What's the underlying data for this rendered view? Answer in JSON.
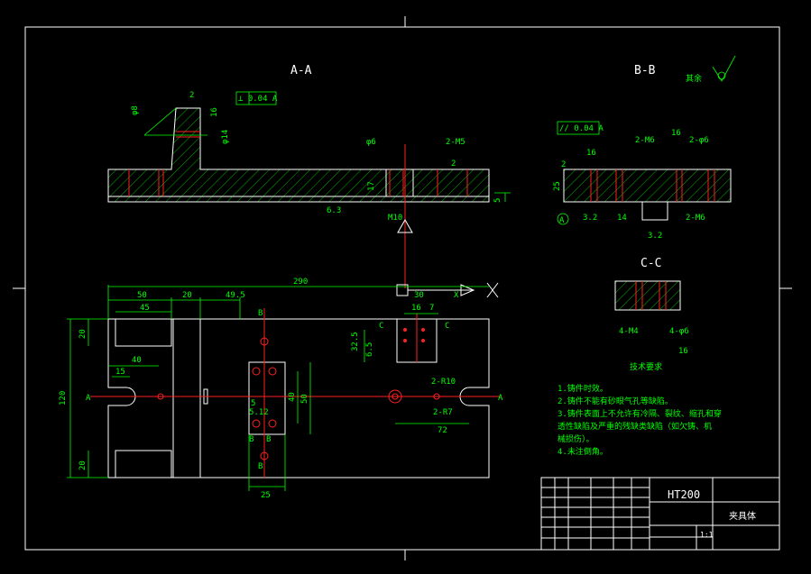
{
  "views": {
    "aa": "A-A",
    "bb": "B-B",
    "cc": "C-C"
  },
  "surface_note": "其余",
  "labels": {
    "lbl_2_top": "2",
    "lbl_tol_aa": "⊥ 0.04 A",
    "lbl_phi14": "φ14",
    "lbl_16_aa": "16",
    "lbl_phi8": "φ8",
    "lbl_63": "6.3",
    "lbl_2m5_aa": "2-M5",
    "lbl_phi6": "φ6",
    "lbl_2_aa": "2",
    "lbl_17": "17",
    "lbl_m10": "M10",
    "lbl_5_aa": "5",
    "lbl_tol_bb": "// 0.04 A",
    "lbl_16_bb": "16",
    "lbl_2m6_bb": "2-M6",
    "lbl_2_bb": "2",
    "lbl_25_bb": "25",
    "lbl_A_circle": "A",
    "lbl_32a": "3.2",
    "lbl_14": "14",
    "lbl_32b": "3.2",
    "lbl_2m6_bb2": "2-M6",
    "lbl_16_bb2": "16",
    "lbl_2m6_bb3": "2-φ6",
    "lbl_4m4": "4-M4",
    "lbl_4phi6": "4-φ6",
    "lbl_16_cc": "16",
    "dim_290": "290",
    "dim_50": "50",
    "dim_20": "20",
    "dim_495": "49.5",
    "dim_45": "45",
    "dim_16": "16",
    "dim_7": "7",
    "dim_C1": "C",
    "dim_C2": "C",
    "dim_325": "32.5",
    "dim_65": "6.5",
    "dim_20a": "20",
    "dim_40": "40",
    "dim_15": "15",
    "dim_120": "120",
    "dim_20b": "20",
    "dim_B1": "B",
    "dim_B2": "B",
    "dim_B3": "B",
    "dim_B4": "B",
    "dim_A_left": "A",
    "dim_A_right": "A",
    "dim_40b": "40",
    "dim_50b": "50",
    "dim_512": "5.12",
    "dim_5": "5",
    "dim_2r10": "2-R10",
    "dim_2r7": "2-R7",
    "dim_72": "72",
    "dim_25": "25",
    "dim_30": "30",
    "axis_x": "X"
  },
  "tech_requirements": {
    "heading": "技术要求",
    "items": [
      "1.铸件时效。",
      "2.铸件不能有砂眼气孔等缺陷。",
      "3.铸件表面上不允许有冷隔、裂纹、缩孔和穿",
      "透性缺陷及严重的残缺类缺陷（如欠铸、机",
      "械损伤）。",
      "4.未注倒角。"
    ]
  },
  "title_block": {
    "material": "HT200",
    "part_name": "夹具体",
    "scale": "1:1"
  }
}
